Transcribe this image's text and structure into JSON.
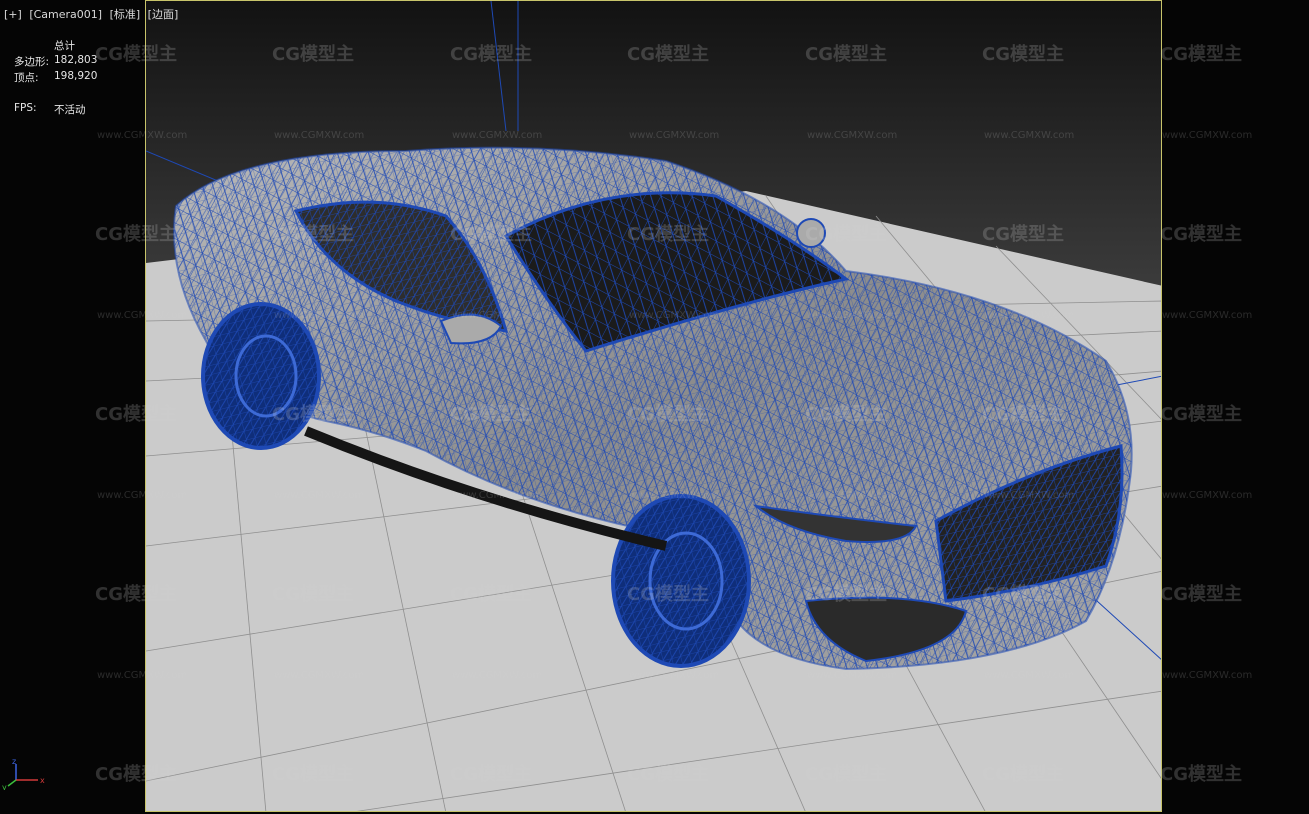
{
  "viewport": {
    "label_items": [
      "[+]",
      "[Camera001]",
      "[标准]",
      "[边面]"
    ]
  },
  "stats": {
    "header": "总计",
    "polygons_label": "多边形:",
    "polygons_value": "182,803",
    "vertices_label": "顶点:",
    "vertices_value": "198,920",
    "fps_label": "FPS:",
    "fps_value": "不活动"
  },
  "watermark": {
    "logo": "CG模型主",
    "url": "www.CGMXW.com"
  },
  "colors": {
    "frame": "#c8c46a",
    "wire": "#1e49b5",
    "grid_floor": "#c9c9c9",
    "background_top": "#141414",
    "background_bottom": "#3a3a3a"
  }
}
